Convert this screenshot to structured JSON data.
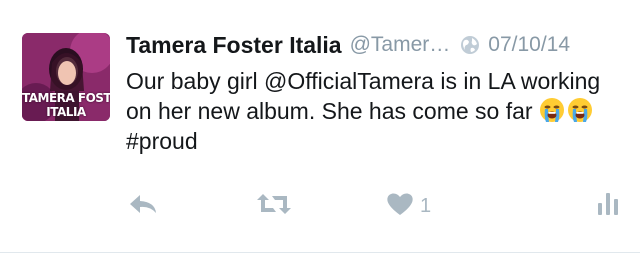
{
  "tweet": {
    "display_name": "Tamera Foster Italia",
    "handle": "@Tamer…",
    "date": "07/10/14",
    "text_parts": {
      "line": "Our baby girl @OfficialTamera is in LA working on her new album. She has come so far ",
      "hashtag": "#proud"
    },
    "avatar_text": [
      "TAMERA FOSTER",
      "ITALIA"
    ],
    "icons": {
      "globe": "globe-icon",
      "emoji": "loudly-crying-face-emoji",
      "reply": "reply-icon",
      "retweet": "retweet-icon",
      "like": "heart-icon",
      "analytics": "analytics-icon"
    },
    "like_count": "1"
  },
  "colors": {
    "text": "#14171a",
    "muted": "#8899a6",
    "icon": "#aab8c2",
    "divider": "#e1e8ed"
  }
}
